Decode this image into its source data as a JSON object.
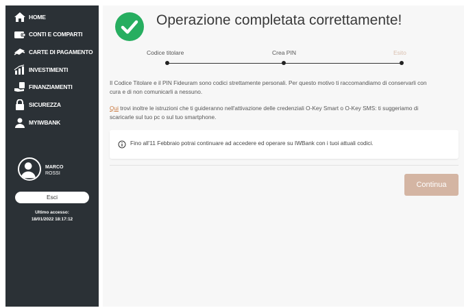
{
  "sidebar": {
    "items": [
      {
        "label": "HOME",
        "icon": "home-icon"
      },
      {
        "label": "CONTI E COMPARTI",
        "icon": "wallet-icon"
      },
      {
        "label": "CARTE DI PAGAMENTO",
        "icon": "card-icon"
      },
      {
        "label": "INVESTIMENTI",
        "icon": "chart-icon"
      },
      {
        "label": "FINANZIAMENTI",
        "icon": "money-hand-icon"
      },
      {
        "label": "SICUREZZA",
        "icon": "lock-icon"
      },
      {
        "label": "MYIWBANK",
        "icon": "user-icon"
      }
    ],
    "user": {
      "first_name": "MARCO",
      "last_name": "ROSSI"
    },
    "logout_label": "Esci",
    "last_access_label": "Ultimo accesso:",
    "last_access_value": "18/01/2022 18:17:12"
  },
  "main": {
    "title": "Operazione completata correttamente!",
    "steps": [
      {
        "label": "Codice titolare",
        "active": true
      },
      {
        "label": "Crea PIN",
        "active": true
      },
      {
        "label": "Esito",
        "active": false
      }
    ],
    "paragraph1": "Il Codice Titolare e il PIN Fideuram sono codici strettamente personali. Per questo motivo ti raccomandiamo di conservarli con cura e di non comunicarli a nessuno.",
    "paragraph2_link": "Qui",
    "paragraph2_rest": " trovi inoltre le istruzioni che ti guideranno nell'attivazione delle credenziali O-Key Smart o O-Key SMS: ti suggeriamo di scaricarle sul tuo pc o sul tuo smartphone.",
    "notice": "Fino all'11 Febbraio potrai continuare ad accedere ed operare su IWBank con i tuoi attuali codici.",
    "continue_label": "Continua"
  },
  "colors": {
    "sidebar_bg": "#2b3136",
    "success_green": "#27ae60",
    "link_orange": "#c8763b",
    "continue_button": "#d4b5a3"
  }
}
